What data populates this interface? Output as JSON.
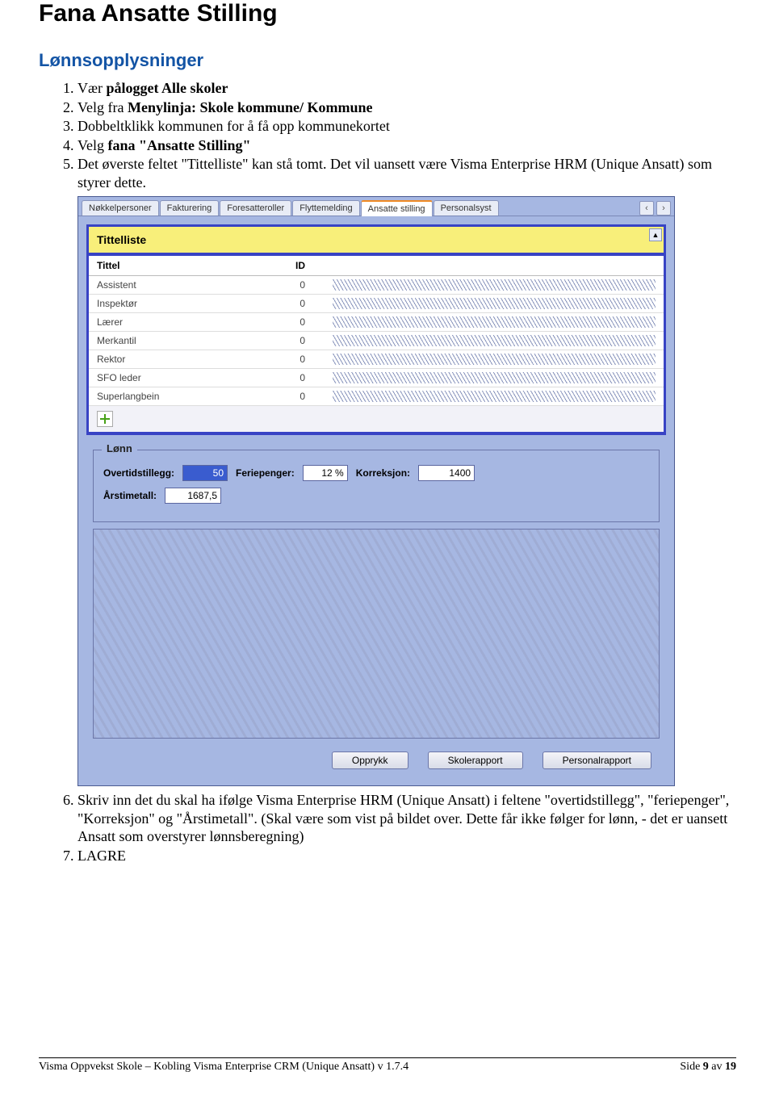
{
  "heading": "Fana Ansatte Stilling",
  "section": "Lønnsopplysninger",
  "steps_a": [
    {
      "pre": "Vær ",
      "bold": "pålogget Alle skoler",
      "post": ""
    },
    {
      "pre": "Velg fra ",
      "bold": "Menylinja: Skole kommune/ Kommune",
      "post": ""
    },
    {
      "pre": "Dobbeltklikk kommunen for å få opp kommunekortet",
      "bold": "",
      "post": ""
    },
    {
      "pre": "Velg ",
      "bold": "fana \"Ansatte Stilling\"",
      "post": ""
    },
    {
      "pre": "Det øverste feltet \"Tittelliste\" kan stå tomt. Det vil uansett være Visma Enterprise HRM (Unique Ansatt) som styrer dette.",
      "bold": "",
      "post": ""
    }
  ],
  "app": {
    "tabs": [
      "Nøkkelpersoner",
      "Fakturering",
      "Foresatteroller",
      "Flyttemelding",
      "Ansatte stilling",
      "Personalsyst"
    ],
    "active_tab_index": 4,
    "panel_title": "Tittelliste",
    "columns": {
      "tittel": "Tittel",
      "id": "ID"
    },
    "rows": [
      {
        "tittel": "Assistent",
        "id": "0"
      },
      {
        "tittel": "Inspektør",
        "id": "0"
      },
      {
        "tittel": "Lærer",
        "id": "0"
      },
      {
        "tittel": "Merkantil",
        "id": "0"
      },
      {
        "tittel": "Rektor",
        "id": "0"
      },
      {
        "tittel": "SFO leder",
        "id": "0"
      },
      {
        "tittel": "Superlangbein",
        "id": "0"
      }
    ],
    "lonn": {
      "legend": "Lønn",
      "overtid_label": "Overtidstillegg:",
      "overtid_value": "50",
      "ferie_label": "Feriepenger:",
      "ferie_value": "12 %",
      "korreksjon_label": "Korreksjon:",
      "korreksjon_value": "1400",
      "arstimetall_label": "Årstimetall:",
      "arstimetall_value": "1687,5"
    },
    "buttons": {
      "opprykk": "Opprykk",
      "skolerapport": "Skolerapport",
      "personalrapport": "Personalrapport"
    }
  },
  "steps_b": [
    "Skriv inn det du skal ha ifølge Visma Enterprise HRM (Unique Ansatt) i feltene \"overtidstillegg\", \"feriepenger\", \"Korreksjon\" og \"Årstimetall\". (Skal være som vist på bildet over. Dette får ikke følger for lønn, - det er uansett Ansatt som overstyrer lønnsberegning)",
    "LAGRE"
  ],
  "footer": {
    "left": "Visma Oppvekst Skole – Kobling Visma Enterprise CRM (Unique Ansatt) v 1.7.4",
    "right_prefix": "Side ",
    "page": "9",
    "of_word": " av ",
    "total": "19"
  }
}
